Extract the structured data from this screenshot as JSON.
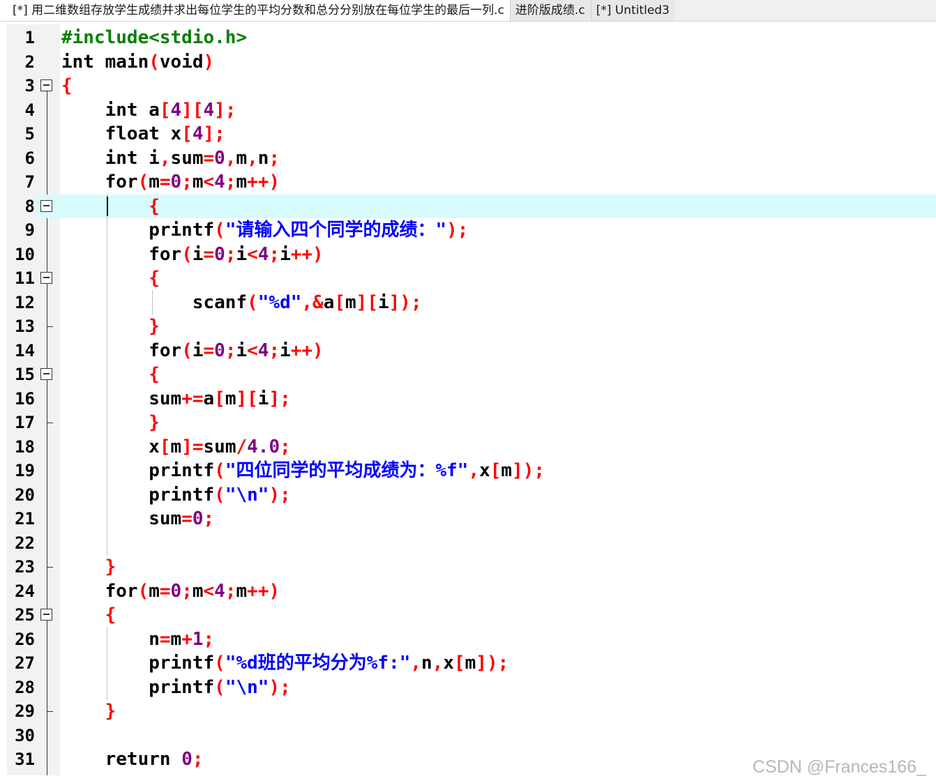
{
  "tabs": [
    {
      "label": "[*] 用二维数组存放学生成绩并求出每位学生的平均分数和总分分别放在每位学生的最后一列.c",
      "active": true
    },
    {
      "label": "进阶版成绩.c",
      "active": false
    },
    {
      "label": "[*] Untitled3",
      "active": false
    }
  ],
  "colors": {
    "keyword": "#000000",
    "preprocessor": "#008000",
    "symbol": "#ff0000",
    "number": "#800080",
    "string": "#0000ff",
    "current_line": "#d7fbfd"
  },
  "editor": {
    "current_line": 8,
    "lines": [
      {
        "n": "1",
        "fold": "",
        "tokens": [
          {
            "t": "#include<stdio.h>",
            "c": "#008000"
          }
        ]
      },
      {
        "n": "2",
        "fold": "",
        "tokens": [
          {
            "t": "int main",
            "c": "#000"
          },
          {
            "t": "(",
            "c": "#f00"
          },
          {
            "t": "void",
            "c": "#000"
          },
          {
            "t": ")",
            "c": "#f00"
          }
        ]
      },
      {
        "n": "3",
        "fold": "open",
        "tokens": [
          {
            "t": "{",
            "c": "#f00"
          }
        ]
      },
      {
        "n": "4",
        "fold": "",
        "tokens": [
          {
            "t": "    int a",
            "c": "#000"
          },
          {
            "t": "[",
            "c": "#f00"
          },
          {
            "t": "4",
            "c": "#800080"
          },
          {
            "t": "][",
            "c": "#f00"
          },
          {
            "t": "4",
            "c": "#800080"
          },
          {
            "t": "];",
            "c": "#f00"
          }
        ]
      },
      {
        "n": "5",
        "fold": "",
        "tokens": [
          {
            "t": "    float x",
            "c": "#000"
          },
          {
            "t": "[",
            "c": "#f00"
          },
          {
            "t": "4",
            "c": "#800080"
          },
          {
            "t": "];",
            "c": "#f00"
          }
        ]
      },
      {
        "n": "6",
        "fold": "",
        "tokens": [
          {
            "t": "    int i",
            "c": "#000"
          },
          {
            "t": ",",
            "c": "#f00"
          },
          {
            "t": "sum",
            "c": "#000"
          },
          {
            "t": "=",
            "c": "#f00"
          },
          {
            "t": "0",
            "c": "#800080"
          },
          {
            "t": ",",
            "c": "#f00"
          },
          {
            "t": "m",
            "c": "#000"
          },
          {
            "t": ",",
            "c": "#f00"
          },
          {
            "t": "n",
            "c": "#000"
          },
          {
            "t": ";",
            "c": "#f00"
          }
        ]
      },
      {
        "n": "7",
        "fold": "",
        "tokens": [
          {
            "t": "    for",
            "c": "#000"
          },
          {
            "t": "(",
            "c": "#f00"
          },
          {
            "t": "m",
            "c": "#000"
          },
          {
            "t": "=",
            "c": "#f00"
          },
          {
            "t": "0",
            "c": "#800080"
          },
          {
            "t": ";",
            "c": "#f00"
          },
          {
            "t": "m",
            "c": "#000"
          },
          {
            "t": "<",
            "c": "#f00"
          },
          {
            "t": "4",
            "c": "#800080"
          },
          {
            "t": ";",
            "c": "#f00"
          },
          {
            "t": "m",
            "c": "#000"
          },
          {
            "t": "++)",
            "c": "#f00"
          }
        ]
      },
      {
        "n": "8",
        "fold": "open",
        "tokens": [
          {
            "t": "        ",
            "c": "#000"
          },
          {
            "t": "{",
            "c": "#f00"
          }
        ]
      },
      {
        "n": "9",
        "fold": "",
        "tokens": [
          {
            "t": "        printf",
            "c": "#000"
          },
          {
            "t": "(",
            "c": "#f00"
          },
          {
            "t": "\"请输入四个同学的成绩：\"",
            "c": "#00f"
          },
          {
            "t": ");",
            "c": "#f00"
          }
        ]
      },
      {
        "n": "10",
        "fold": "",
        "tokens": [
          {
            "t": "        for",
            "c": "#000"
          },
          {
            "t": "(",
            "c": "#f00"
          },
          {
            "t": "i",
            "c": "#000"
          },
          {
            "t": "=",
            "c": "#f00"
          },
          {
            "t": "0",
            "c": "#800080"
          },
          {
            "t": ";",
            "c": "#f00"
          },
          {
            "t": "i",
            "c": "#000"
          },
          {
            "t": "<",
            "c": "#f00"
          },
          {
            "t": "4",
            "c": "#800080"
          },
          {
            "t": ";",
            "c": "#f00"
          },
          {
            "t": "i",
            "c": "#000"
          },
          {
            "t": "++)",
            "c": "#f00"
          }
        ]
      },
      {
        "n": "11",
        "fold": "open",
        "tokens": [
          {
            "t": "        ",
            "c": "#000"
          },
          {
            "t": "{",
            "c": "#f00"
          }
        ]
      },
      {
        "n": "12",
        "fold": "",
        "tokens": [
          {
            "t": "            scanf",
            "c": "#000"
          },
          {
            "t": "(",
            "c": "#f00"
          },
          {
            "t": "\"%d\"",
            "c": "#00f"
          },
          {
            "t": ",&",
            "c": "#f00"
          },
          {
            "t": "a",
            "c": "#000"
          },
          {
            "t": "[",
            "c": "#f00"
          },
          {
            "t": "m",
            "c": "#000"
          },
          {
            "t": "][",
            "c": "#f00"
          },
          {
            "t": "i",
            "c": "#000"
          },
          {
            "t": "]);",
            "c": "#f00"
          }
        ]
      },
      {
        "n": "13",
        "fold": "end",
        "tokens": [
          {
            "t": "        ",
            "c": "#000"
          },
          {
            "t": "}",
            "c": "#f00"
          }
        ]
      },
      {
        "n": "14",
        "fold": "",
        "tokens": [
          {
            "t": "        for",
            "c": "#000"
          },
          {
            "t": "(",
            "c": "#f00"
          },
          {
            "t": "i",
            "c": "#000"
          },
          {
            "t": "=",
            "c": "#f00"
          },
          {
            "t": "0",
            "c": "#800080"
          },
          {
            "t": ";",
            "c": "#f00"
          },
          {
            "t": "i",
            "c": "#000"
          },
          {
            "t": "<",
            "c": "#f00"
          },
          {
            "t": "4",
            "c": "#800080"
          },
          {
            "t": ";",
            "c": "#f00"
          },
          {
            "t": "i",
            "c": "#000"
          },
          {
            "t": "++)",
            "c": "#f00"
          }
        ]
      },
      {
        "n": "15",
        "fold": "open",
        "tokens": [
          {
            "t": "        ",
            "c": "#000"
          },
          {
            "t": "{",
            "c": "#f00"
          }
        ]
      },
      {
        "n": "16",
        "fold": "",
        "tokens": [
          {
            "t": "        sum",
            "c": "#000"
          },
          {
            "t": "+=",
            "c": "#f00"
          },
          {
            "t": "a",
            "c": "#000"
          },
          {
            "t": "[",
            "c": "#f00"
          },
          {
            "t": "m",
            "c": "#000"
          },
          {
            "t": "][",
            "c": "#f00"
          },
          {
            "t": "i",
            "c": "#000"
          },
          {
            "t": "];",
            "c": "#f00"
          }
        ]
      },
      {
        "n": "17",
        "fold": "end",
        "tokens": [
          {
            "t": "        ",
            "c": "#000"
          },
          {
            "t": "}",
            "c": "#f00"
          }
        ]
      },
      {
        "n": "18",
        "fold": "",
        "tokens": [
          {
            "t": "        x",
            "c": "#000"
          },
          {
            "t": "[",
            "c": "#f00"
          },
          {
            "t": "m",
            "c": "#000"
          },
          {
            "t": "]=",
            "c": "#f00"
          },
          {
            "t": "sum",
            "c": "#000"
          },
          {
            "t": "/",
            "c": "#f00"
          },
          {
            "t": "4.0",
            "c": "#800080"
          },
          {
            "t": ";",
            "c": "#f00"
          }
        ]
      },
      {
        "n": "19",
        "fold": "",
        "tokens": [
          {
            "t": "        printf",
            "c": "#000"
          },
          {
            "t": "(",
            "c": "#f00"
          },
          {
            "t": "\"四位同学的平均成绩为：%f\"",
            "c": "#00f"
          },
          {
            "t": ",",
            "c": "#f00"
          },
          {
            "t": "x",
            "c": "#000"
          },
          {
            "t": "[",
            "c": "#f00"
          },
          {
            "t": "m",
            "c": "#000"
          },
          {
            "t": "]);",
            "c": "#f00"
          }
        ]
      },
      {
        "n": "20",
        "fold": "",
        "tokens": [
          {
            "t": "        printf",
            "c": "#000"
          },
          {
            "t": "(",
            "c": "#f00"
          },
          {
            "t": "\"\\n\"",
            "c": "#00f"
          },
          {
            "t": ");",
            "c": "#f00"
          }
        ]
      },
      {
        "n": "21",
        "fold": "",
        "tokens": [
          {
            "t": "        sum",
            "c": "#000"
          },
          {
            "t": "=",
            "c": "#f00"
          },
          {
            "t": "0",
            "c": "#800080"
          },
          {
            "t": ";",
            "c": "#f00"
          }
        ]
      },
      {
        "n": "22",
        "fold": "",
        "tokens": []
      },
      {
        "n": "23",
        "fold": "end",
        "tokens": [
          {
            "t": "    ",
            "c": "#000"
          },
          {
            "t": "}",
            "c": "#f00"
          }
        ]
      },
      {
        "n": "24",
        "fold": "",
        "tokens": [
          {
            "t": "    for",
            "c": "#000"
          },
          {
            "t": "(",
            "c": "#f00"
          },
          {
            "t": "m",
            "c": "#000"
          },
          {
            "t": "=",
            "c": "#f00"
          },
          {
            "t": "0",
            "c": "#800080"
          },
          {
            "t": ";",
            "c": "#f00"
          },
          {
            "t": "m",
            "c": "#000"
          },
          {
            "t": "<",
            "c": "#f00"
          },
          {
            "t": "4",
            "c": "#800080"
          },
          {
            "t": ";",
            "c": "#f00"
          },
          {
            "t": "m",
            "c": "#000"
          },
          {
            "t": "++)",
            "c": "#f00"
          }
        ]
      },
      {
        "n": "25",
        "fold": "open",
        "tokens": [
          {
            "t": "    ",
            "c": "#000"
          },
          {
            "t": "{",
            "c": "#f00"
          }
        ]
      },
      {
        "n": "26",
        "fold": "",
        "tokens": [
          {
            "t": "        n",
            "c": "#000"
          },
          {
            "t": "=",
            "c": "#f00"
          },
          {
            "t": "m",
            "c": "#000"
          },
          {
            "t": "+",
            "c": "#f00"
          },
          {
            "t": "1",
            "c": "#800080"
          },
          {
            "t": ";",
            "c": "#f00"
          }
        ]
      },
      {
        "n": "27",
        "fold": "",
        "tokens": [
          {
            "t": "        printf",
            "c": "#000"
          },
          {
            "t": "(",
            "c": "#f00"
          },
          {
            "t": "\"%d班的平均分为%f:\"",
            "c": "#00f"
          },
          {
            "t": ",",
            "c": "#f00"
          },
          {
            "t": "n",
            "c": "#000"
          },
          {
            "t": ",",
            "c": "#f00"
          },
          {
            "t": "x",
            "c": "#000"
          },
          {
            "t": "[",
            "c": "#f00"
          },
          {
            "t": "m",
            "c": "#000"
          },
          {
            "t": "]);",
            "c": "#f00"
          }
        ]
      },
      {
        "n": "28",
        "fold": "",
        "tokens": [
          {
            "t": "        printf",
            "c": "#000"
          },
          {
            "t": "(",
            "c": "#f00"
          },
          {
            "t": "\"\\n\"",
            "c": "#00f"
          },
          {
            "t": ");",
            "c": "#f00"
          }
        ]
      },
      {
        "n": "29",
        "fold": "end",
        "tokens": [
          {
            "t": "    ",
            "c": "#000"
          },
          {
            "t": "}",
            "c": "#f00"
          }
        ]
      },
      {
        "n": "30",
        "fold": "",
        "tokens": []
      },
      {
        "n": "31",
        "fold": "",
        "tokens": [
          {
            "t": "    return ",
            "c": "#000"
          },
          {
            "t": "0",
            "c": "#800080"
          },
          {
            "t": ";",
            "c": "#f00"
          }
        ]
      }
    ]
  },
  "watermark": "CSDN @Frances166_"
}
